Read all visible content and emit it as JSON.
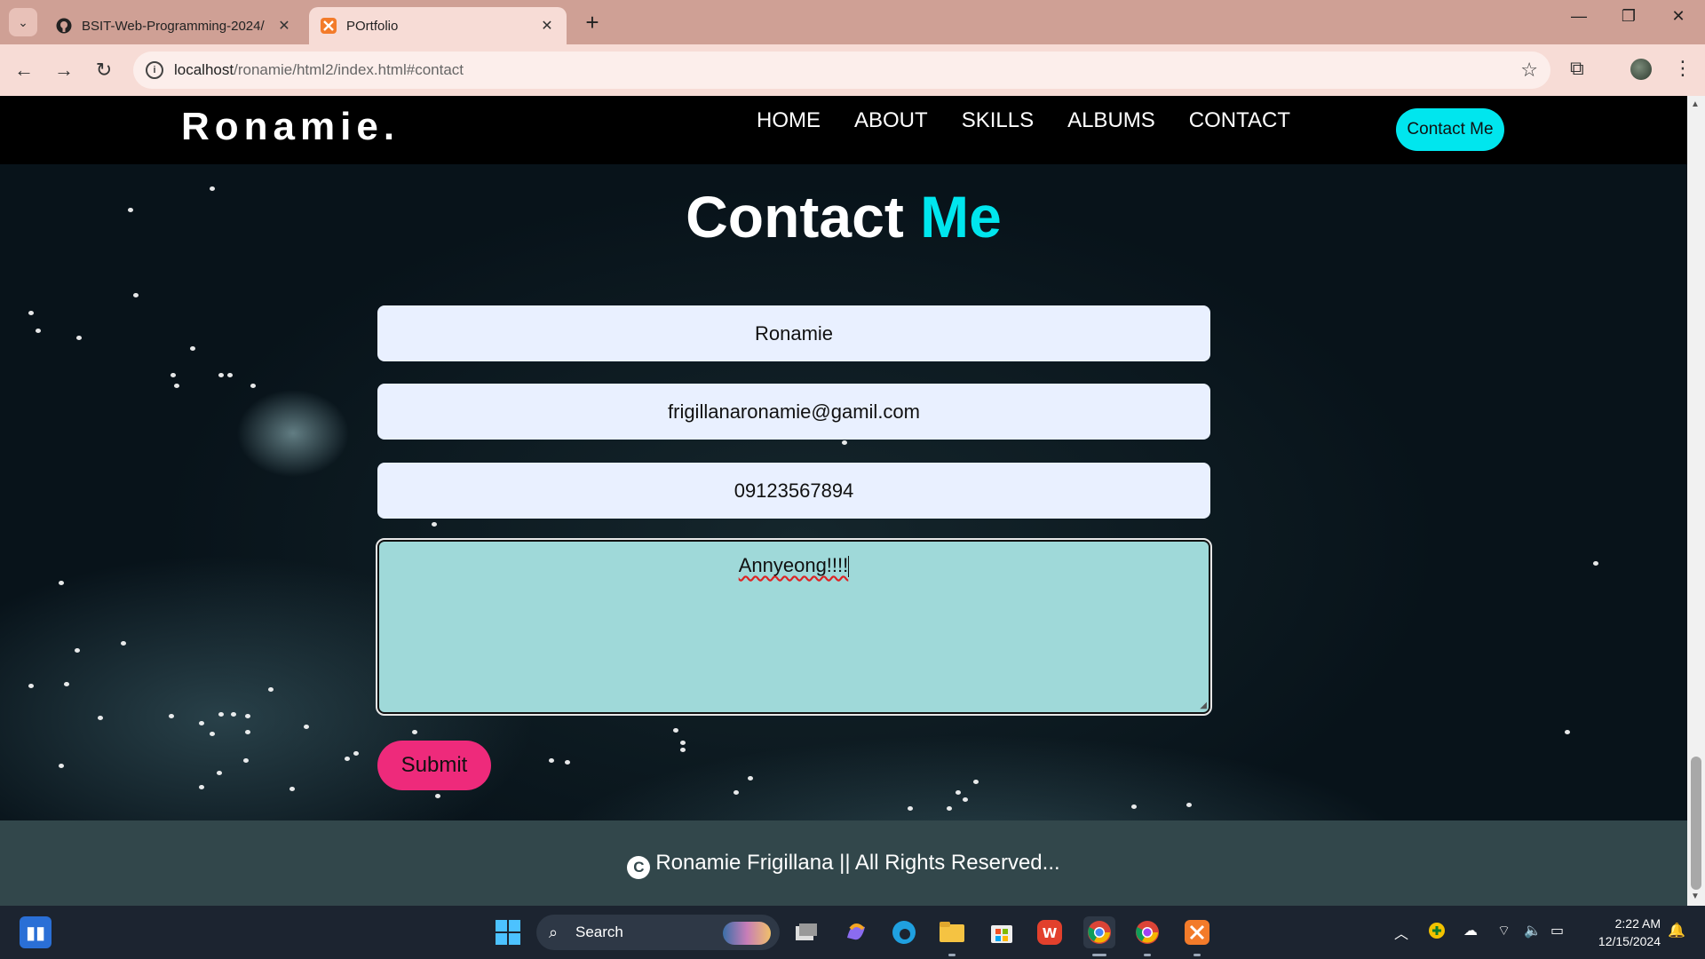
{
  "browser": {
    "tabs": [
      {
        "title": "BSIT-Web-Programming-2024/",
        "favicon": "github-icon",
        "active": false
      },
      {
        "title": "POrtfolio",
        "favicon": "xampp-icon",
        "active": true
      }
    ],
    "url_host": "localhost",
    "url_path": "/ronamie/html2/index.html#contact"
  },
  "site": {
    "logo": "Ronamie.",
    "nav": [
      "HOME",
      "ABOUT",
      "SKILLS",
      "ALBUMS",
      "CONTACT"
    ],
    "contact_button": "Contact Me"
  },
  "contact": {
    "title_main": "Contact",
    "title_accent": "Me",
    "name_value": "Ronamie",
    "email_value": "frigillanaronamie@gamil.com",
    "phone_value": "09123567894",
    "message_value": "Annyeong!!!!",
    "submit_label": "Submit"
  },
  "footer": {
    "text": "Ronamie Frigillana || All Rights Reserved..."
  },
  "taskbar": {
    "search_label": "Search",
    "time": "2:22 AM",
    "date": "12/15/2024"
  },
  "colors": {
    "accent_cyan": "#00e6ee",
    "submit_pink": "#ee2a7b",
    "footer_bg": "#32474b",
    "browser_frame": "#cfa095"
  }
}
